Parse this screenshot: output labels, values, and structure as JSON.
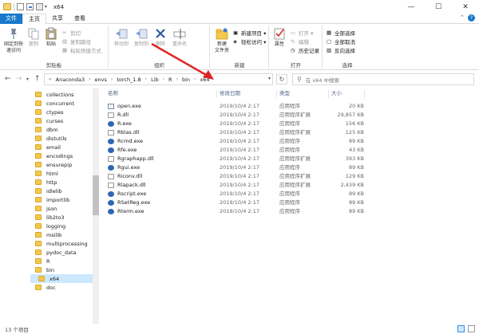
{
  "window": {
    "title": "x64",
    "controls": {
      "minimize": "—",
      "maximize": "☐",
      "close": "✕"
    }
  },
  "ribbon_tabs": [
    "文件",
    "主页",
    "共享",
    "查看"
  ],
  "ribbon": {
    "clipboard": {
      "pin_label_1": "固定到快",
      "pin_label_2": "速访问",
      "copy": "复制",
      "paste": "粘贴",
      "copy_path": "复制路径",
      "paste_shortcut": "粘贴快捷方式",
      "cut": "剪切",
      "group": "剪贴板"
    },
    "organize": {
      "move_to": "移动到",
      "copy_to": "复制到",
      "delete": "删除",
      "rename": "重命名",
      "group": "组织"
    },
    "new": {
      "new_folder_1": "新建",
      "new_folder_2": "文件夹",
      "new_item": "新建项目 ▾",
      "easy_access": "轻松访问 ▾",
      "group": "新建"
    },
    "open": {
      "properties": "属性",
      "open": "打开 ▾",
      "edit": "编辑",
      "history": "历史记录",
      "group": "打开"
    },
    "select": {
      "select_all": "全部选择",
      "select_none": "全部取消",
      "invert": "反向选择",
      "group": "选择"
    }
  },
  "address": {
    "crumbs": [
      "Anaconda3",
      "envs",
      "torch_1.8",
      "Lib",
      "R",
      "bin",
      "x64"
    ],
    "search_placeholder": "在 x64 中搜索"
  },
  "tree": [
    {
      "label": "collections"
    },
    {
      "label": "concurrent"
    },
    {
      "label": "ctypes"
    },
    {
      "label": "curses"
    },
    {
      "label": "dbm"
    },
    {
      "label": "distutils"
    },
    {
      "label": "email"
    },
    {
      "label": "encodings"
    },
    {
      "label": "ensurepip"
    },
    {
      "label": "html"
    },
    {
      "label": "http"
    },
    {
      "label": "idlelib"
    },
    {
      "label": "importlib"
    },
    {
      "label": "json"
    },
    {
      "label": "lib2to3"
    },
    {
      "label": "logging"
    },
    {
      "label": "msilib"
    },
    {
      "label": "multiprocessing"
    },
    {
      "label": "pydoc_data"
    },
    {
      "label": "R"
    },
    {
      "label": "bin"
    },
    {
      "label": "x64"
    },
    {
      "label": "doc"
    }
  ],
  "columns": {
    "name": "名称",
    "date": "修改日期",
    "type": "类型",
    "size": "大小"
  },
  "files": [
    {
      "name": "open.exe",
      "date": "2019/10/4 2:17",
      "type": "应用程序",
      "size": "20 KB",
      "icon": "exe-icon"
    },
    {
      "name": "R.dll",
      "date": "2019/10/4 2:17",
      "type": "应用程序扩展",
      "size": "29,857 KB",
      "icon": "dll-icon"
    },
    {
      "name": "R.exe",
      "date": "2019/10/4 2:17",
      "type": "应用程序",
      "size": "156 KB",
      "icon": "r-icon"
    },
    {
      "name": "Rblas.dll",
      "date": "2019/10/4 2:17",
      "type": "应用程序扩展",
      "size": "125 KB",
      "icon": "dll-icon"
    },
    {
      "name": "Rcmd.exe",
      "date": "2019/10/4 2:17",
      "type": "应用程序",
      "size": "89 KB",
      "icon": "r-icon"
    },
    {
      "name": "Rfe.exe",
      "date": "2019/10/4 2:17",
      "type": "应用程序",
      "size": "43 KB",
      "icon": "r-icon"
    },
    {
      "name": "Rgraphapp.dll",
      "date": "2019/10/4 2:17",
      "type": "应用程序扩展",
      "size": "393 KB",
      "icon": "dll-icon"
    },
    {
      "name": "Rgui.exe",
      "date": "2019/10/4 2:17",
      "type": "应用程序",
      "size": "89 KB",
      "icon": "r-icon"
    },
    {
      "name": "Riconv.dll",
      "date": "2019/10/4 2:17",
      "type": "应用程序扩展",
      "size": "129 KB",
      "icon": "dll-icon"
    },
    {
      "name": "Rlapack.dll",
      "date": "2019/10/4 2:17",
      "type": "应用程序扩展",
      "size": "2,439 KB",
      "icon": "dll-icon"
    },
    {
      "name": "Rscript.exe",
      "date": "2019/10/4 2:17",
      "type": "应用程序",
      "size": "89 KB",
      "icon": "r-icon"
    },
    {
      "name": "RSetReg.exe",
      "date": "2019/10/4 2:17",
      "type": "应用程序",
      "size": "89 KB",
      "icon": "r-icon"
    },
    {
      "name": "Rterm.exe",
      "date": "2019/10/4 2:17",
      "type": "应用程序",
      "size": "89 KB",
      "icon": "r-icon"
    }
  ],
  "status": {
    "count": "13 个项目"
  },
  "colors": {
    "file_tab": "#1979ca",
    "selection": "#cce8ff",
    "arrow": "#e02424",
    "folder": "#f2c94c"
  }
}
